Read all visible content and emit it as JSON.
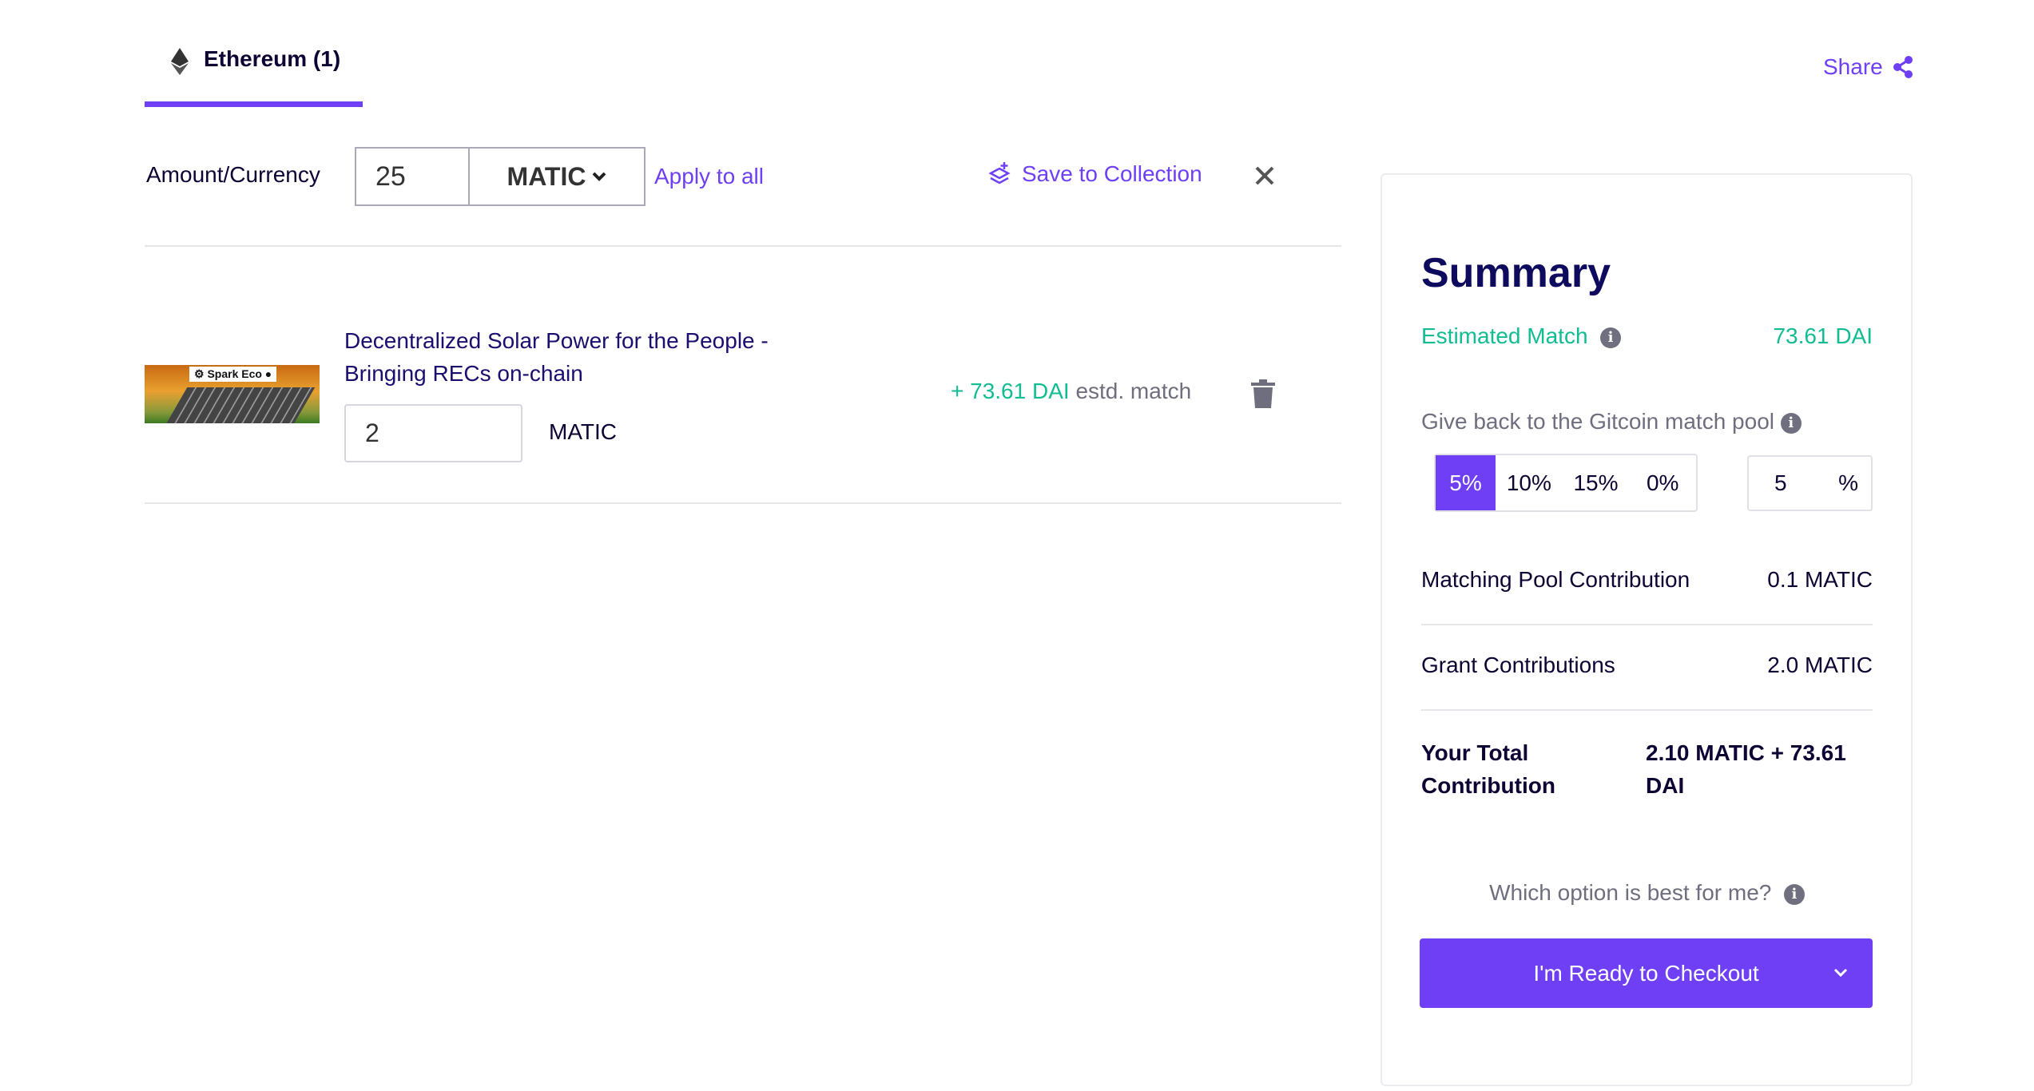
{
  "tabs": [
    {
      "label": "Ethereum (1)",
      "icon": "ethereum-icon",
      "active": true
    }
  ],
  "share": {
    "label": "Share",
    "icon": "share-icon"
  },
  "amount_row": {
    "label": "Amount/Currency",
    "amount": "25",
    "currency": "MATIC",
    "apply_all": "Apply to all",
    "save_collection": "Save to Collection"
  },
  "grants": [
    {
      "title_line1": "Decentralized Solar Power for the People -",
      "title_line2": "Bringing RECs on-chain",
      "image_label": "Spark Eco",
      "amount": "2",
      "currency": "MATIC",
      "match_value": "+ 73.61 DAI",
      "match_suffix": "estd. match"
    }
  ],
  "summary": {
    "title": "Summary",
    "estimated_match_label": "Estimated Match",
    "estimated_match_value": "73.61 DAI",
    "give_back_label": "Give back to the Gitcoin match pool",
    "options": [
      "5%",
      "10%",
      "15%",
      "0%"
    ],
    "selected_option": "5%",
    "custom_value": "5",
    "custom_unit": "%",
    "matching_pool_label": "Matching Pool Contribution",
    "matching_pool_value": "0.1 MATIC",
    "grant_contrib_label": "Grant Contributions",
    "grant_contrib_value": "2.0 MATIC",
    "total_label_1": "Your Total",
    "total_label_2": "Contribution",
    "total_value_1": "2.10 MATIC + 73.61",
    "total_value_2": "DAI",
    "which_option": "Which option is best for me?",
    "checkout_label": "I'm Ready to Checkout"
  },
  "colors": {
    "accent": "#6f3ff5",
    "match_green": "#11bc92",
    "text_dark": "#0e0333"
  }
}
